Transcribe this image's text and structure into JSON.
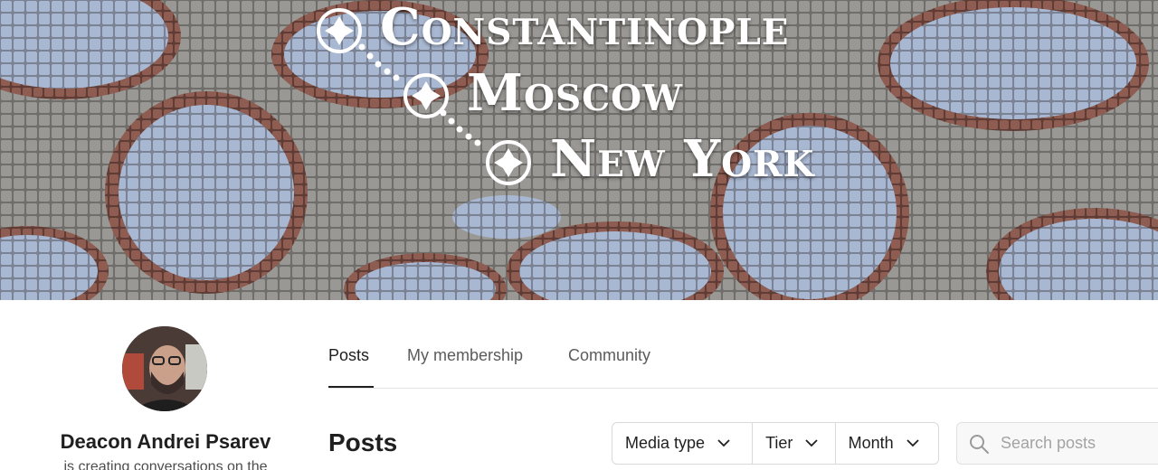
{
  "banner": {
    "cities": [
      "Constantinople",
      "Moscow",
      "New York"
    ],
    "mosaic_colors": {
      "grey": "#8d8b86",
      "blue": "#9fb0cc",
      "red": "#8a5a4e"
    }
  },
  "creator": {
    "name": "Deacon Andrei Psarev",
    "tagline": "is creating conversations on the"
  },
  "tabs": [
    {
      "label": "Posts",
      "active": true
    },
    {
      "label": "My membership",
      "active": false
    },
    {
      "label": "Community",
      "active": false
    }
  ],
  "posts": {
    "heading": "Posts",
    "filters": [
      {
        "label": "Media type"
      },
      {
        "label": "Tier"
      },
      {
        "label": "Month"
      }
    ],
    "search_placeholder": "Search posts"
  }
}
